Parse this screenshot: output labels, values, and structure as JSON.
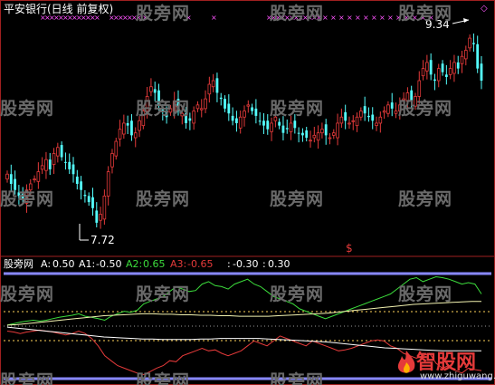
{
  "header": {
    "title": "平安银行(日线 前复权)"
  },
  "price_labels": {
    "high": "9.34",
    "low": "7.72"
  },
  "watermark_text": "股旁网",
  "indicator": {
    "name": "股旁网",
    "items": [
      {
        "label": "A:",
        "value": "0.50",
        "color": "#ffffff"
      },
      {
        "label": "A1:",
        "value": "-0.50",
        "color": "#ffffff"
      },
      {
        "label": "A2:",
        "value": "0.65",
        "color": "#3cdc3c"
      },
      {
        "label": "A3:",
        "value": "-0.65",
        "color": "#e53a3a"
      },
      {
        "label": ":",
        "value": "-0.30",
        "color": "#ffffff"
      },
      {
        "label": ":",
        "value": "0.30",
        "color": "#ffffff"
      }
    ]
  },
  "brand": {
    "name": "智股网",
    "url": "www.zhiguwang.com"
  },
  "colors": {
    "up": "#e53a3a",
    "down": "#54ffff",
    "marker": "#ff55ff",
    "border": "#a02020",
    "band": "#8888ff",
    "ref": "#ffd35a"
  },
  "chart_data": [
    {
      "type": "candlestick",
      "title": "平安银行(日线 前复权)",
      "annotations": [
        {
          "text": "9.34",
          "kind": "high"
        },
        {
          "text": "7.72",
          "kind": "low"
        }
      ],
      "ylim": [
        7.6,
        9.45
      ],
      "close": [
        8.18,
        8.1,
        8.05,
        8.0,
        7.98,
        8.05,
        8.1,
        8.14,
        8.2,
        8.25,
        8.3,
        8.22,
        8.35,
        8.4,
        8.32,
        8.28,
        8.22,
        8.18,
        8.1,
        8.05,
        8.0,
        7.95,
        7.9,
        7.78,
        7.85,
        8.0,
        8.2,
        8.35,
        8.45,
        8.55,
        8.6,
        8.58,
        8.5,
        8.52,
        8.62,
        8.7,
        8.82,
        8.9,
        8.85,
        8.75,
        8.7,
        8.65,
        8.72,
        8.78,
        8.7,
        8.68,
        8.6,
        8.62,
        8.7,
        8.75,
        8.72,
        8.8,
        8.92,
        8.95,
        8.85,
        8.8,
        8.72,
        8.68,
        8.62,
        8.6,
        8.65,
        8.7,
        8.75,
        8.7,
        8.66,
        8.62,
        8.58,
        8.55,
        8.6,
        8.65,
        8.58,
        8.52,
        8.55,
        8.6,
        8.56,
        8.52,
        8.5,
        8.48,
        8.46,
        8.5,
        8.52,
        8.55,
        8.5,
        8.48,
        8.52,
        8.6,
        8.65,
        8.62,
        8.6,
        8.62,
        8.65,
        8.7,
        8.68,
        8.65,
        8.62,
        8.6,
        8.65,
        8.7,
        8.75,
        8.72,
        8.7,
        8.75,
        8.8,
        8.85,
        8.78,
        8.82,
        8.95,
        9.05,
        9.1,
        9.0,
        8.95,
        9.05,
        9.02,
        8.98,
        9.05,
        9.1,
        9.05,
        9.15,
        9.2,
        9.3,
        9.25,
        9.05,
        8.95
      ]
    },
    {
      "type": "line",
      "series": [
        {
          "name": "A2",
          "color": "#3cdc3c",
          "values": [
            0.02,
            0.05,
            0.08,
            0.1,
            0.12,
            0.1,
            0.12,
            0.15,
            0.18,
            0.2,
            0.22,
            0.25,
            0.2,
            0.18,
            0.15,
            0.12,
            0.2,
            0.25,
            0.3,
            0.28,
            0.32,
            0.45,
            0.5,
            0.55,
            0.6,
            0.7,
            0.8,
            0.75,
            0.7,
            0.72,
            0.85,
            0.9,
            0.82,
            0.8,
            0.75,
            0.85,
            0.9,
            0.95,
            0.85,
            0.8,
            0.7,
            0.6,
            0.55,
            0.5,
            0.45,
            0.35,
            0.3,
            0.25,
            0.2,
            0.15,
            0.2,
            0.25,
            0.3,
            0.35,
            0.4,
            0.45,
            0.5,
            0.55,
            0.6,
            0.65,
            0.75,
            0.85,
            0.95,
            0.98,
            0.9,
            0.95,
            1.0,
            0.98,
            0.95,
            0.9,
            0.85,
            0.88,
            0.85,
            0.65
          ]
        },
        {
          "name": "A3",
          "color": "#e53a3a",
          "values": [
            -0.1,
            -0.12,
            -0.15,
            -0.12,
            -0.1,
            -0.08,
            -0.1,
            -0.12,
            -0.15,
            -0.18,
            -0.15,
            -0.1,
            -0.15,
            -0.25,
            -0.4,
            -0.6,
            -0.7,
            -0.8,
            -0.85,
            -0.9,
            -0.95,
            -0.98,
            -0.92,
            -0.85,
            -0.8,
            -0.7,
            -0.72,
            -0.6,
            -0.55,
            -0.5,
            -0.45,
            -0.5,
            -0.48,
            -0.55,
            -0.6,
            -0.55,
            -0.5,
            -0.4,
            -0.3,
            -0.35,
            -0.4,
            -0.3,
            -0.2,
            -0.25,
            -0.3,
            -0.35,
            -0.4,
            -0.3,
            -0.35,
            -0.4,
            -0.45,
            -0.5,
            -0.48,
            -0.45,
            -0.4,
            -0.35,
            -0.3,
            -0.28,
            -0.3,
            -0.4,
            -0.45,
            -0.55,
            -0.6,
            -0.65,
            -0.6,
            -0.55,
            -0.75,
            -0.85,
            -0.8,
            -0.9,
            -0.95,
            -0.85,
            -0.88,
            -0.9
          ]
        },
        {
          "name": "A",
          "color": "#f2f2b0",
          "values": [
            0.02,
            0.03,
            0.05,
            0.07,
            0.09,
            0.11,
            0.13,
            0.15,
            0.17,
            0.19,
            0.21,
            0.22,
            0.23,
            0.24,
            0.25,
            0.25,
            0.24,
            0.24,
            0.23,
            0.23,
            0.22,
            0.22,
            0.21,
            0.21,
            0.2,
            0.2,
            0.2,
            0.2,
            0.21,
            0.22,
            0.23,
            0.24,
            0.25,
            0.26,
            0.28,
            0.3,
            0.32,
            0.34,
            0.36,
            0.38,
            0.4,
            0.42,
            0.44,
            0.45,
            0.46,
            0.47,
            0.48,
            0.49,
            0.5,
            0.5
          ]
        },
        {
          "name": "A1",
          "color": "#ffffff",
          "values": [
            -0.02,
            -0.04,
            -0.06,
            -0.08,
            -0.1,
            -0.12,
            -0.14,
            -0.16,
            -0.18,
            -0.2,
            -0.22,
            -0.23,
            -0.24,
            -0.25,
            -0.26,
            -0.26,
            -0.27,
            -0.27,
            -0.27,
            -0.27,
            -0.26,
            -0.26,
            -0.25,
            -0.25,
            -0.25,
            -0.25,
            -0.25,
            -0.26,
            -0.27,
            -0.28,
            -0.29,
            -0.3,
            -0.31,
            -0.32,
            -0.34,
            -0.36,
            -0.38,
            -0.4,
            -0.42,
            -0.44,
            -0.45,
            -0.46,
            -0.47,
            -0.48,
            -0.49,
            -0.5,
            -0.5,
            -0.5,
            -0.5,
            -0.5
          ]
        }
      ],
      "reference_lines": [
        0.3,
        -0.3
      ],
      "bands": [
        1,
        -1
      ],
      "ylim": [
        -1.1,
        1.1
      ]
    }
  ]
}
